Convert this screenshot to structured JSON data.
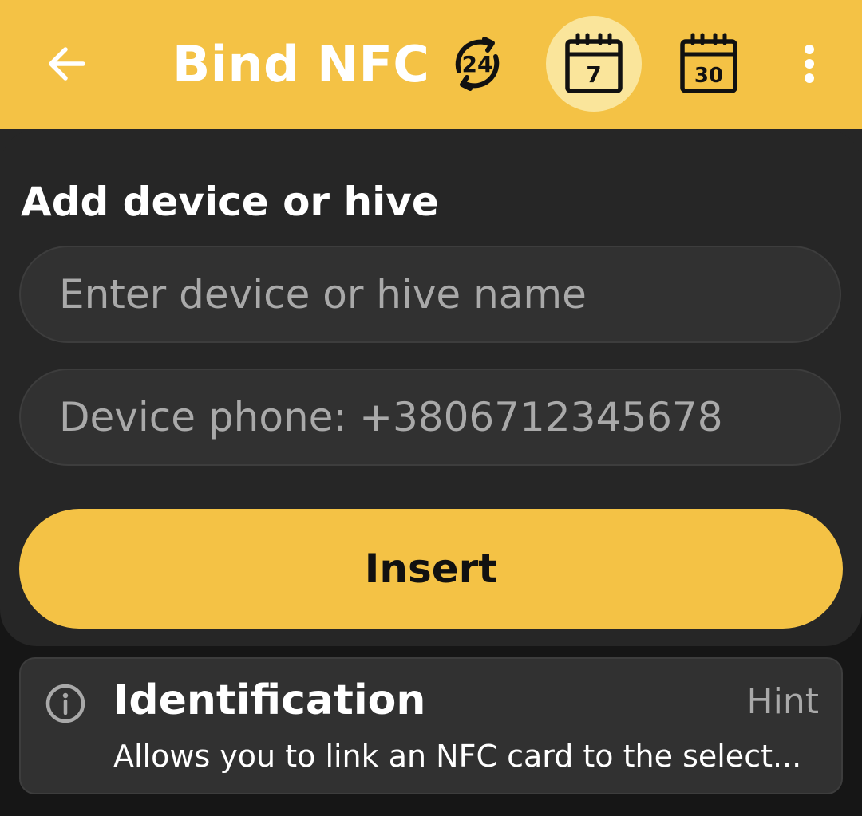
{
  "header": {
    "title": "Bind NFC",
    "period_24h_label": "24",
    "period_7d_label": "7",
    "period_30d_label": "30",
    "active_period": "7",
    "accent_color": "#f4c245",
    "icons": [
      "back-arrow-icon",
      "period-24h-icon",
      "calendar-7-days-icon",
      "calendar-30-days-icon",
      "more-vertical-icon"
    ]
  },
  "form": {
    "title": "Add device or hive",
    "name_placeholder": "Enter device or hive name",
    "name_value": "",
    "phone_placeholder": "Device phone: +3806712345678",
    "phone_value": "",
    "insert_label": "Insert"
  },
  "hint": {
    "title": "Identification",
    "link_label": "Hint",
    "text": "Allows you to link an NFC card to the select..."
  }
}
